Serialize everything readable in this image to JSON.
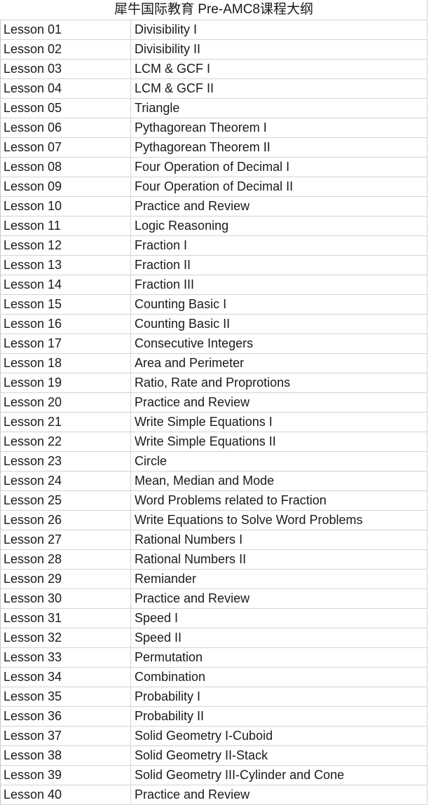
{
  "document": {
    "title": "犀牛国际教育 Pre-AMC8课程大纲",
    "table": {
      "rows": [
        {
          "lesson": "Lesson 01",
          "topic": "Divisibility I"
        },
        {
          "lesson": "Lesson 02",
          "topic": "Divisibility II"
        },
        {
          "lesson": "Lesson 03",
          "topic": "LCM & GCF I"
        },
        {
          "lesson": "Lesson 04",
          "topic": "LCM & GCF II"
        },
        {
          "lesson": "Lesson 05",
          "topic": "Triangle"
        },
        {
          "lesson": "Lesson 06",
          "topic": "Pythagorean Theorem I"
        },
        {
          "lesson": "Lesson 07",
          "topic": "Pythagorean Theorem II"
        },
        {
          "lesson": "Lesson 08",
          "topic": "Four Operation of Decimal I"
        },
        {
          "lesson": "Lesson 09",
          "topic": "Four Operation of Decimal II"
        },
        {
          "lesson": "Lesson 10",
          "topic": "Practice and Review"
        },
        {
          "lesson": "Lesson 11",
          "topic": "Logic Reasoning"
        },
        {
          "lesson": "Lesson 12",
          "topic": "Fraction I"
        },
        {
          "lesson": "Lesson 13",
          "topic": "Fraction II"
        },
        {
          "lesson": "Lesson 14",
          "topic": "Fraction III"
        },
        {
          "lesson": "Lesson 15",
          "topic": "Counting Basic I"
        },
        {
          "lesson": "Lesson 16",
          "topic": "Counting Basic II"
        },
        {
          "lesson": "Lesson 17",
          "topic": "Consecutive Integers"
        },
        {
          "lesson": "Lesson 18",
          "topic": "Area and Perimeter"
        },
        {
          "lesson": "Lesson 19",
          "topic": "Ratio, Rate and Proprotions"
        },
        {
          "lesson": "Lesson 20",
          "topic": "Practice and Review"
        },
        {
          "lesson": "Lesson 21",
          "topic": "Write Simple Equations I"
        },
        {
          "lesson": "Lesson 22",
          "topic": "Write Simple Equations II"
        },
        {
          "lesson": "Lesson 23",
          "topic": "Circle"
        },
        {
          "lesson": "Lesson 24",
          "topic": "Mean, Median and Mode"
        },
        {
          "lesson": "Lesson 25",
          "topic": "Word Problems related to Fraction"
        },
        {
          "lesson": "Lesson 26",
          "topic": "Write Equations to Solve Word Problems"
        },
        {
          "lesson": "Lesson 27",
          "topic": "Rational Numbers I"
        },
        {
          "lesson": "Lesson 28",
          "topic": "Rational Numbers II"
        },
        {
          "lesson": "Lesson 29",
          "topic": "Remiander"
        },
        {
          "lesson": "Lesson 30",
          "topic": "Practice and Review"
        },
        {
          "lesson": "Lesson 31",
          "topic": "Speed I"
        },
        {
          "lesson": "Lesson 32",
          "topic": "Speed II"
        },
        {
          "lesson": "Lesson 33",
          "topic": "Permutation"
        },
        {
          "lesson": "Lesson 34",
          "topic": "Combination"
        },
        {
          "lesson": "Lesson 35",
          "topic": "Probability I"
        },
        {
          "lesson": "Lesson 36",
          "topic": "Probability II"
        },
        {
          "lesson": "Lesson 37",
          "topic": "Solid Geometry I-Cuboid"
        },
        {
          "lesson": "Lesson 38",
          "topic": "Solid Geometry II-Stack"
        },
        {
          "lesson": "Lesson 39",
          "topic": "Solid Geometry III-Cylinder and Cone"
        },
        {
          "lesson": "Lesson 40",
          "topic": "Practice and Review"
        }
      ]
    }
  },
  "colors": {
    "text": "#1a1a1a",
    "border": "#d4d4d4",
    "background": "#ffffff"
  }
}
